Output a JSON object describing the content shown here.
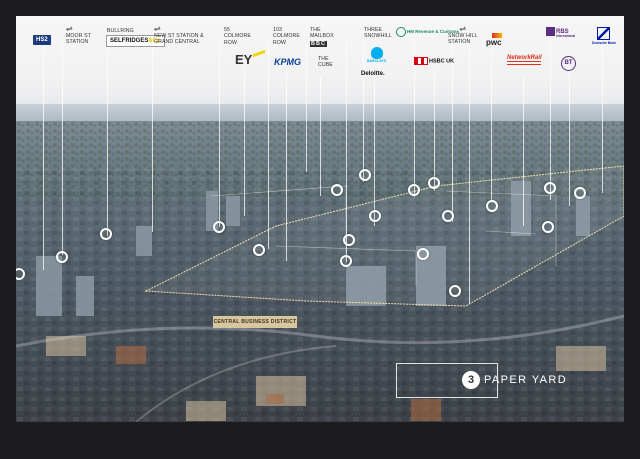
{
  "labels": {
    "moor_st": [
      "MOOR ST",
      "STATION"
    ],
    "bullring": [
      "BULLRING"
    ],
    "new_st": [
      "NEW ST STATION &",
      "GRAND CENTRAL"
    ],
    "colmore_55": [
      "55",
      "COLMORE",
      "ROW"
    ],
    "colmore_103": [
      "103",
      "COLMORE",
      "ROW"
    ],
    "mailbox": [
      "THE",
      "MAILBOX"
    ],
    "cube": [
      "THE",
      "CUBE"
    ],
    "three_snowhill": [
      "THREE",
      "SNOWHILL"
    ],
    "snow_hill": [
      "SNOW HILL",
      "STATION"
    ]
  },
  "logos": {
    "hs2": "HS2",
    "selfridges": "SELFRIDGES",
    "selfridges_suffix": "&Co",
    "ey": "EY",
    "kpmg": "KPMG",
    "bbc": "BBC",
    "barclays": "BARCLAYS",
    "deloitte": "Deloitte.",
    "hmrc": "HM Revenue & Customs",
    "hsbc": "HSBC UK",
    "pwc": "pwc",
    "network_rail": "NetworkRail",
    "rbs": "RBS",
    "rbs_sub": "International",
    "bt": "BT",
    "deutsche": "Deutsche Bank"
  },
  "map": {
    "district_label": "CENTRAL BUSINESS DISTRICT",
    "brand_initial": "3",
    "brand_name": "PAPER YARD"
  },
  "colors": {
    "hs2": "#1d3a7a",
    "kpmg": "#0a3f9c",
    "rbs": "#5a2d82",
    "hsbc": "#db0011",
    "pwc": "#e0301e",
    "network_rail": "#e0301e",
    "deutsche": "#0018a8",
    "district_tag": "#d8c79e"
  }
}
